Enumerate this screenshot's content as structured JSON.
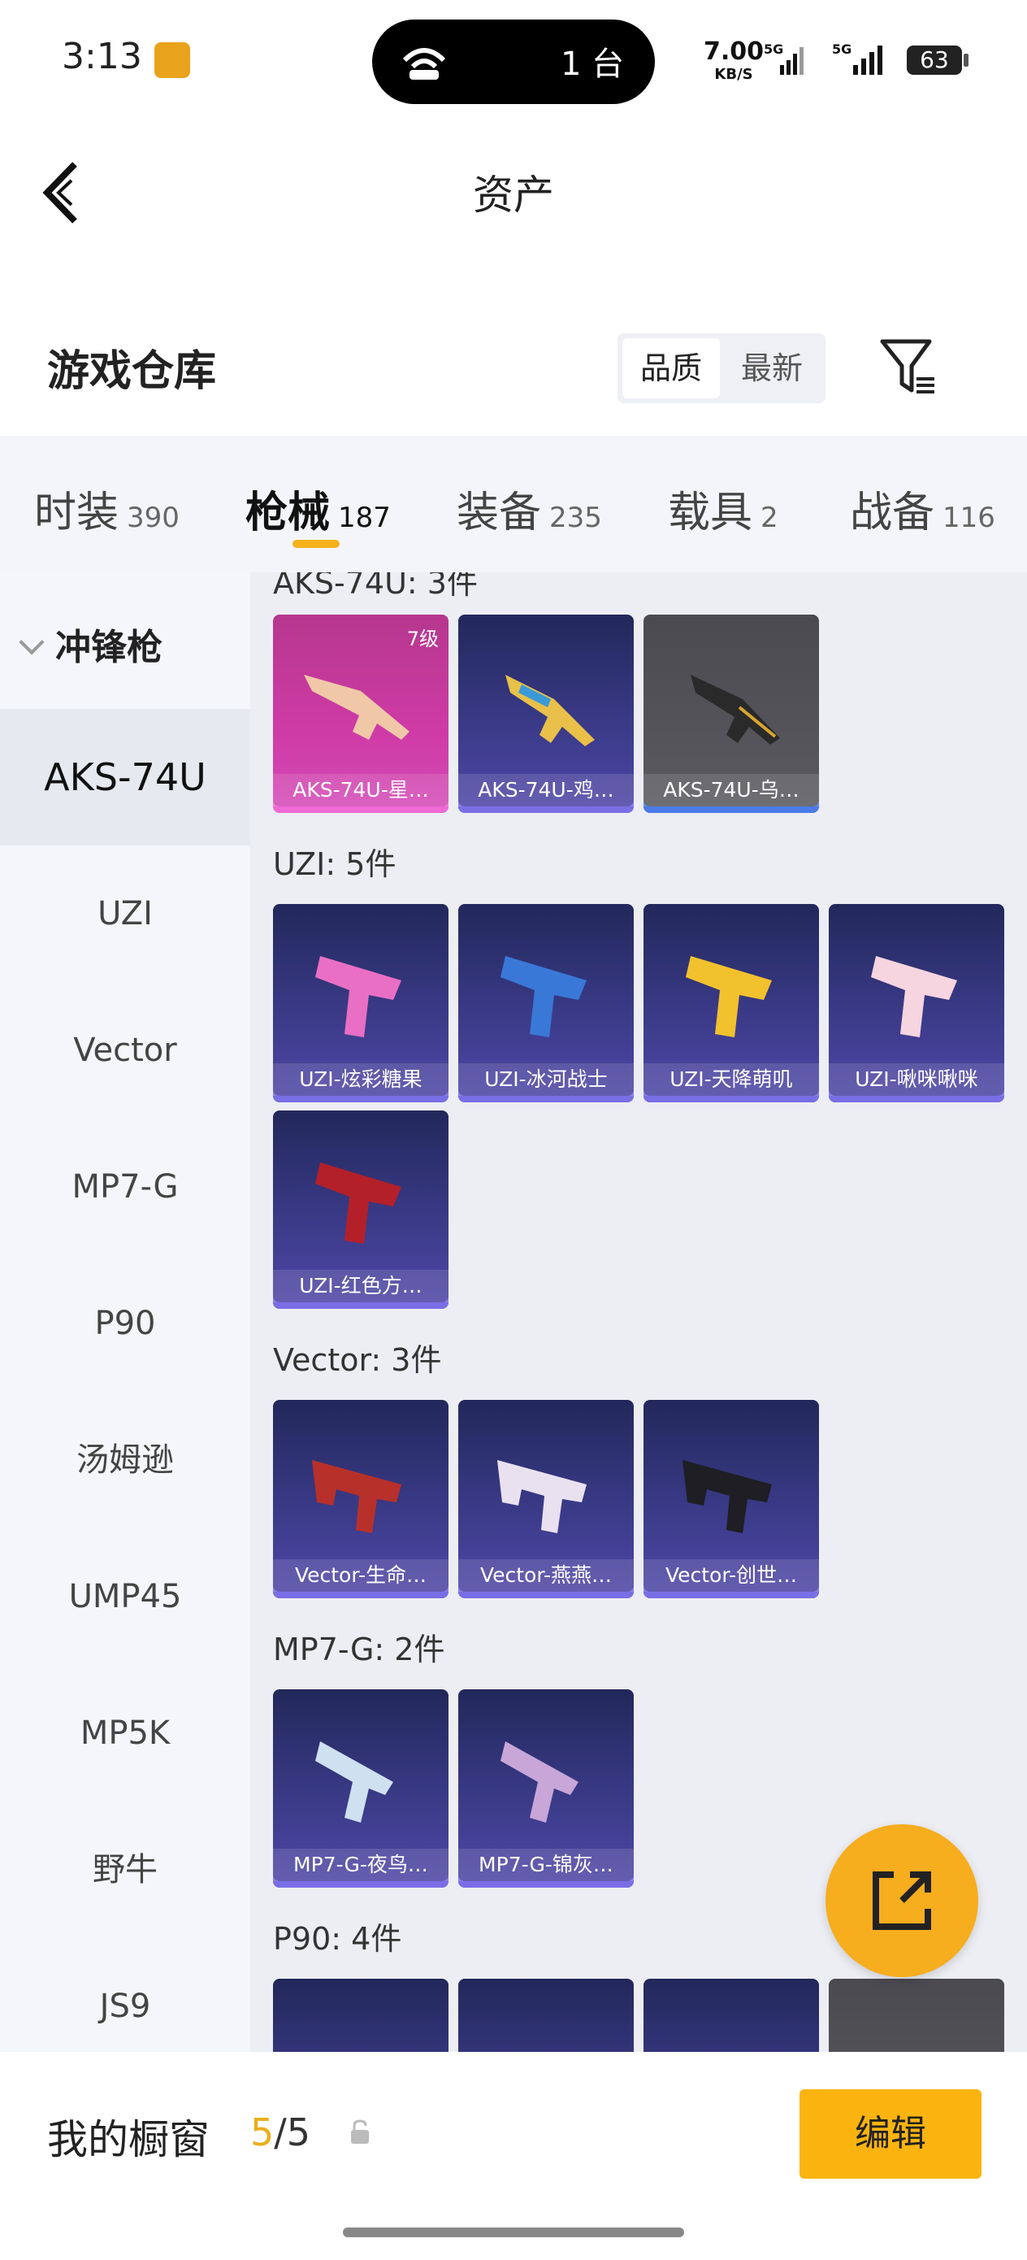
{
  "status": {
    "time": "3:13",
    "island_text": "1 台",
    "net_speed": "7.00",
    "net_unit": "KB/S",
    "signal1": "5G",
    "signal2": "5G",
    "battery": "63"
  },
  "header": {
    "title": "资产",
    "warehouse_title": "游戏仓库",
    "sort_quality": "品质",
    "sort_newest": "最新"
  },
  "tabs": [
    {
      "label": "时装",
      "count": "390"
    },
    {
      "label": "枪械",
      "count": "187"
    },
    {
      "label": "装备",
      "count": "235"
    },
    {
      "label": "载具",
      "count": "2"
    },
    {
      "label": "战备",
      "count": "116"
    }
  ],
  "sidebar": {
    "category": "冲锋枪",
    "items": [
      "AKS-74U",
      "UZI",
      "Vector",
      "MP7-G",
      "P90",
      "汤姆逊",
      "UMP45",
      "MP5K",
      "野牛",
      "JS9"
    ]
  },
  "sections": [
    {
      "title": "AKS-74U: 3件",
      "items": [
        {
          "name": "AKS-74U-星…",
          "level": "7级",
          "color": "#ee6ad4"
        },
        {
          "name": "AKS-74U-鸡…",
          "color": "#7a6ee6"
        },
        {
          "name": "AKS-74U-乌…",
          "color": "#4b7be8"
        }
      ]
    },
    {
      "title": "UZI: 5件",
      "items": [
        {
          "name": "UZI-炫彩糖果"
        },
        {
          "name": "UZI-冰河战士"
        },
        {
          "name": "UZI-天降萌叽"
        },
        {
          "name": "UZI-啾咪啾咪"
        },
        {
          "name": "UZI-红色方…"
        }
      ]
    },
    {
      "title": "Vector: 3件",
      "items": [
        {
          "name": "Vector-生命…"
        },
        {
          "name": "Vector-燕燕…"
        },
        {
          "name": "Vector-创世…"
        }
      ]
    },
    {
      "title": "MP7-G: 2件",
      "items": [
        {
          "name": "MP7-G-夜鸟…"
        },
        {
          "name": "MP7-G-锦灰…"
        }
      ]
    },
    {
      "title": "P90: 4件",
      "items": [
        {
          "name": ""
        },
        {
          "name": ""
        },
        {
          "name": ""
        },
        {
          "name": ""
        }
      ]
    }
  ],
  "bottom": {
    "showcase_label": "我的橱窗",
    "showcase_current": "5",
    "showcase_total": "/5",
    "edit_label": "编辑"
  }
}
